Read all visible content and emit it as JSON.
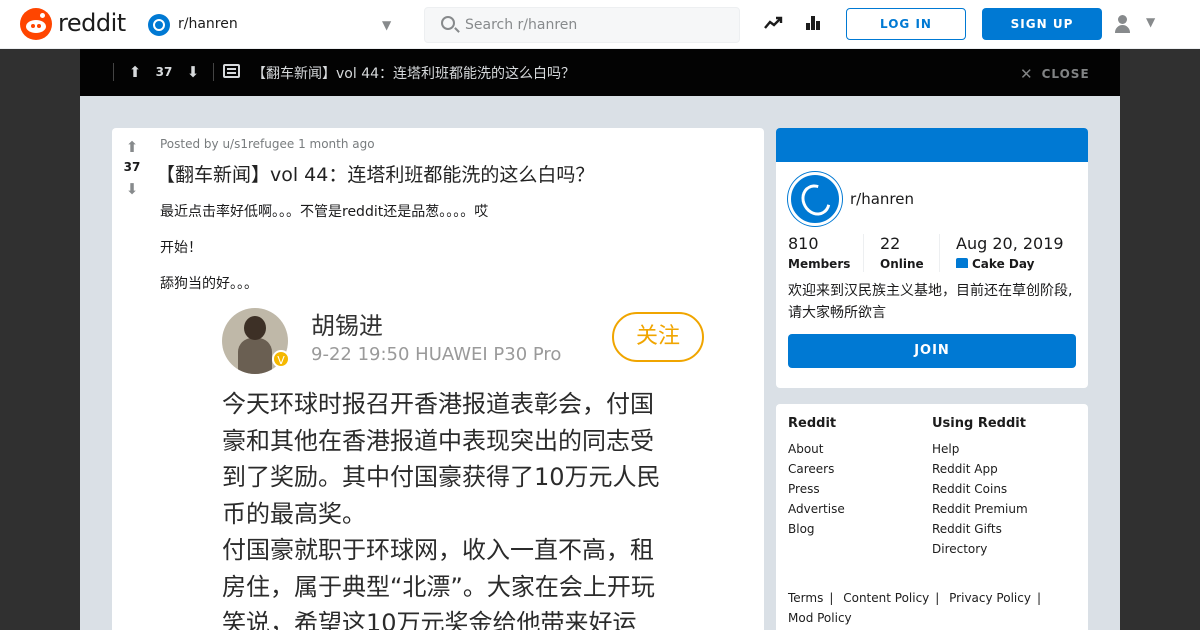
{
  "header": {
    "logo_text": "reddit",
    "subreddit": "r/hanren",
    "search_placeholder": "Search r/hanren",
    "login_label": "LOG IN",
    "signup_label": "SIGN UP"
  },
  "overlay": {
    "score": "37",
    "title": "【翻车新闻】vol 44：连塔利班都能洗的这么白吗？",
    "close_label": "CLOSE"
  },
  "post": {
    "meta": "Posted by u/s1refugee 1 month ago",
    "score": "37",
    "title": "【翻车新闻】vol 44：连塔利班都能洗的这么白吗？",
    "body": [
      "最近点击率好低啊。。。不管是reddit还是品葱。。。。哎",
      "开始！",
      "舔狗当的好。。。"
    ],
    "image": {
      "author": "胡锡进",
      "date_device": "9-22 19:50   HUAWEI P30 Pro",
      "follow_label": "关注",
      "badge_text": "V",
      "lines": [
        "今天环球时报召开香港报道表彰会，付国",
        "豪和其他在香港报道中表现突出的同志受",
        "到了奖励。其中付国豪获得了10万元人民",
        "币的最高奖。",
        "付国豪就职于环球网，收入一直不高，租",
        "房住，属于典型“北漂”。大家在会上开玩",
        "笑说，希望这10万元奖金给他带来好运"
      ]
    }
  },
  "about": {
    "name": "r/hanren",
    "members": "810",
    "members_label": "Members",
    "online": "22",
    "online_label": "Online",
    "created": "Aug 20, 2019",
    "created_label": "Cake Day",
    "description": "欢迎来到汉民族主义基地，目前还在草创阶段,请大家畅所欲言",
    "join_label": "JOIN"
  },
  "footer": {
    "col1_title": "Reddit",
    "col1": [
      "About",
      "Careers",
      "Press",
      "Advertise",
      "Blog"
    ],
    "col2_title": "Using Reddit",
    "col2": [
      "Help",
      "Reddit App",
      "Reddit Coins",
      "Reddit Premium",
      "Reddit Gifts",
      "Directory"
    ],
    "policies": [
      "Terms",
      "Content Policy",
      "Privacy Policy",
      "Mod Policy"
    ]
  },
  "colors": {
    "brand": "#ff4500",
    "accent": "#0079d3",
    "overlay": "#030303",
    "page_bg": "#dae0e6"
  }
}
